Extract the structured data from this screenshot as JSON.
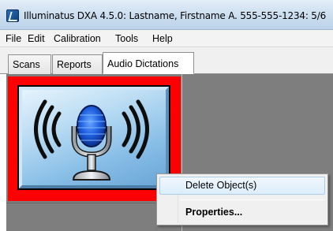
{
  "window": {
    "title": "Illuminatus DXA 4.5.0: Lastname, Firstname A. 555-555-1234: 5/6"
  },
  "menubar": {
    "items": [
      {
        "label": "File"
      },
      {
        "label": "Edit"
      },
      {
        "label": "Calibration"
      },
      {
        "label": "Tools"
      },
      {
        "label": "Help"
      }
    ]
  },
  "tabs": [
    {
      "label": "Scans"
    },
    {
      "label": "Reports"
    },
    {
      "label": "Audio Dictations",
      "active": true
    }
  ],
  "thumbnail": {
    "icon": "microphone-icon",
    "selected": true,
    "selection_color": "#ff0000"
  },
  "context_menu": {
    "items": [
      {
        "label": "Delete Object(s)",
        "hover": true
      },
      {
        "label": "Properties...",
        "bold": true
      }
    ]
  }
}
